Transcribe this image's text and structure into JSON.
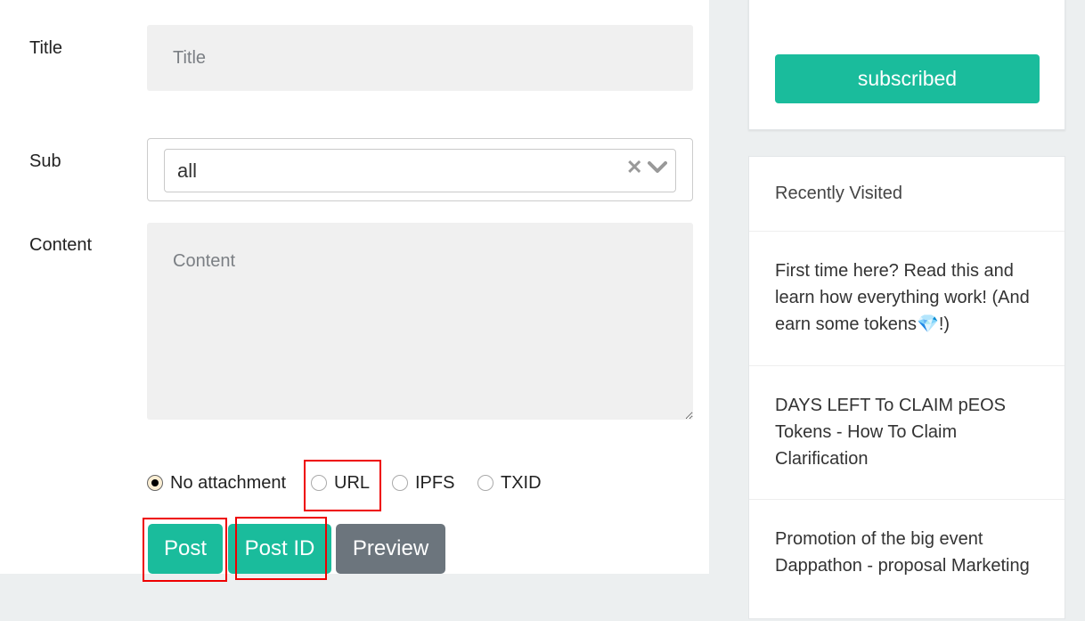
{
  "form": {
    "title_label": "Title",
    "title_placeholder": "Title",
    "sub_label": "Sub",
    "sub_value": "all",
    "sub_clear_symbol": "✕",
    "content_label": "Content",
    "content_placeholder": "Content",
    "attachment_options": [
      {
        "label": "No attachment",
        "checked": true
      },
      {
        "label": "URL",
        "checked": false
      },
      {
        "label": "IPFS",
        "checked": false
      },
      {
        "label": "TXID",
        "checked": false
      }
    ],
    "buttons": {
      "post": "Post",
      "post_id": "Post ID",
      "preview": "Preview"
    }
  },
  "sidebar": {
    "subscribed_label": "subscribed",
    "recently_visited_title": "Recently Visited",
    "recent_items": [
      "First time here? Read this and learn how everything work! (And earn some tokens💎!)",
      "DAYS LEFT To CLAIM pEOS Tokens - How To Claim Clarification",
      "Promotion of the big event Dappathon - proposal Marketing"
    ]
  },
  "colors": {
    "accent": "#1abc9c",
    "secondary_button": "#6c757d",
    "highlight": "#ee0000",
    "page_background": "#eceff0"
  }
}
